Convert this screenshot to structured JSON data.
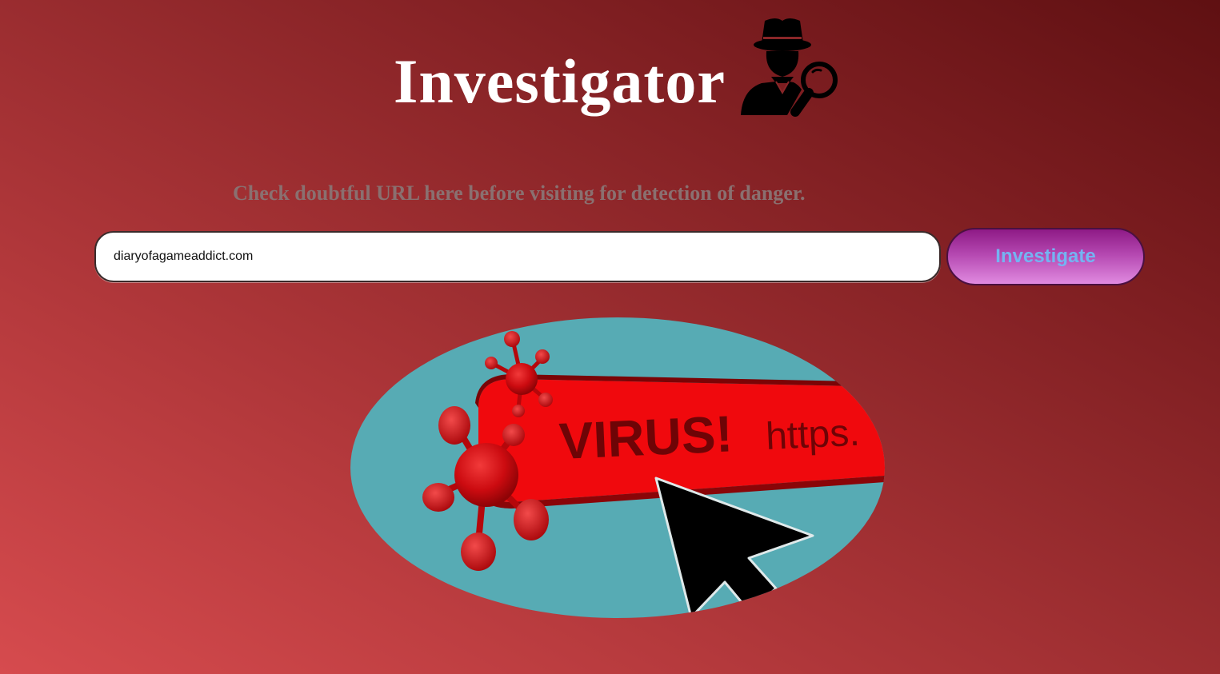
{
  "header": {
    "title": "Investigator",
    "icon": "detective-icon"
  },
  "subtitle": "Check doubtful URL here before visiting for detection of danger.",
  "search": {
    "value": "diaryofagameaddict.com",
    "placeholder": ""
  },
  "investigate_button": {
    "label": "Investigate"
  },
  "illustration": {
    "banner_text": "VIRUS!",
    "url_text": "https.",
    "icon": "virus-alert-illustration"
  },
  "colors": {
    "title": "#ffffff",
    "subtitle": "#8a7070",
    "button_text": "#74b4f2",
    "button_top": "#8e1a86",
    "button_bottom": "#e08ae0",
    "illustration_bg": "#57abb4",
    "virus_red": "#e30a0f"
  }
}
